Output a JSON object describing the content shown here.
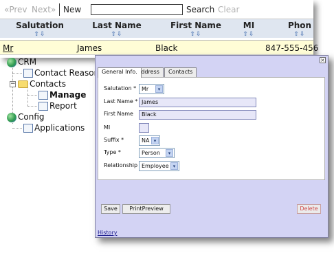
{
  "toolbar": {
    "prev_label": "«Prev",
    "next_label": "Next»",
    "new_label": "New",
    "search_value": "",
    "search_label": "Search",
    "clear_label": "Clear"
  },
  "grid": {
    "columns": [
      {
        "label": "Salutation",
        "arrows": "⇧⇩"
      },
      {
        "label": "Last Name",
        "arrows": "⇧⇩"
      },
      {
        "label": "First Name",
        "arrows": "⇧⇩"
      },
      {
        "label": "MI",
        "arrows": "⇧⇩"
      },
      {
        "label": "Phon",
        "arrows": "⇧⇩"
      }
    ],
    "row": {
      "salutation": "Mr",
      "last_name": "James",
      "first_name": "Black",
      "phone": "847-555-456"
    }
  },
  "tree": {
    "crm": "CRM",
    "contact_reasons": "Contact Reasons",
    "contacts": "Contacts",
    "manage": "Manage",
    "report": "Report",
    "config": "Config",
    "applications": "Applications",
    "minus_glyph": "−"
  },
  "dialog": {
    "close_glyph": "×",
    "tabs": [
      "General Info.",
      "Address",
      "Contacts"
    ],
    "fields": {
      "salutation": {
        "label": "Salutation *",
        "value": "Mr"
      },
      "last_name": {
        "label": "Last Name *",
        "value": "James"
      },
      "first_name": {
        "label": "First Name",
        "value": "Black"
      },
      "mi": {
        "label": "MI",
        "value": ""
      },
      "suffix": {
        "label": "Suffix *",
        "value": "NA"
      },
      "type": {
        "label": "Type *",
        "value": "Person"
      },
      "relationship": {
        "label": "Relationship *",
        "value": "Employee"
      }
    },
    "caret_glyph": "▾",
    "save_label": "Save",
    "print_label": "PrintPreview",
    "delete_label": "Delete",
    "history_label": "History"
  },
  "colors": {
    "dialog_bg": "#d3d3f4",
    "header_bg": "#dfe6f0",
    "selected_row_bg": "#fffdd6",
    "delete_text": "#d04848"
  }
}
